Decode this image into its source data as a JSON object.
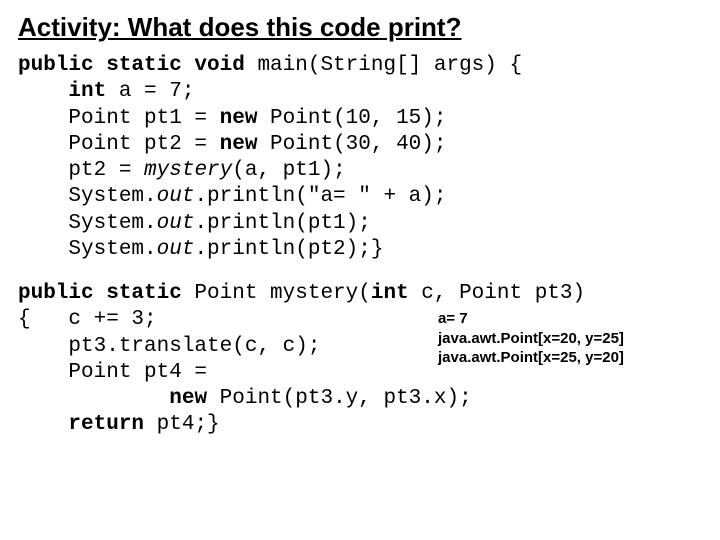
{
  "title": "Activity:  What does this code print?",
  "code": {
    "main_sig_open": "public static void",
    "main_sig_rest": " main(String[] args) {",
    "l2a": "int",
    "l2b": " a = 7;",
    "l3a": "    Point pt1 = ",
    "l3b": "new",
    "l3c": " Point(10, 15);",
    "l4a": "    Point pt2 = ",
    "l4b": "new",
    "l4c": " Point(30, 40);",
    "l5a": "    pt2 = ",
    "l5b": "mystery",
    "l5c": "(a, pt1);",
    "l6a": "    System.",
    "l6b": "out",
    "l6c": ".println(\"a= \" + a);",
    "l7a": "    System.",
    "l7b": "out",
    "l7c": ".println(pt1);",
    "l8a": "    System.",
    "l8b": "out",
    "l8c": ".println(pt2);}",
    "m_sig_open": "public static",
    "m_sig_mid": " Point mystery(",
    "m_sig_int": "int",
    "m_sig_rest": " c, Point pt3)",
    "m_l2": "{   c += 3;",
    "m_l3": "    pt3.translate(c, c);",
    "m_l4": "    Point pt4 =",
    "m_l5a": "            ",
    "m_l5b": "new",
    "m_l5c": " Point(pt3.y, pt3.x);",
    "m_l6a": "    ",
    "m_l6b": "return",
    "m_l6c": " pt4;}"
  },
  "output": {
    "line1": "a= 7",
    "line2": "java.awt.Point[x=20, y=25]",
    "line3": "java.awt.Point[x=25, y=20]"
  }
}
